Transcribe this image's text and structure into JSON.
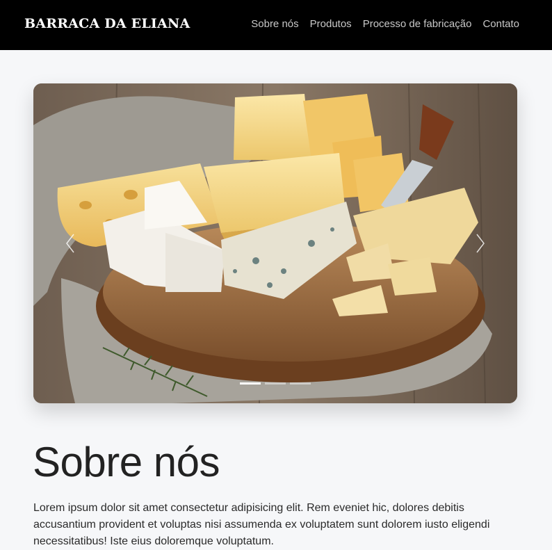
{
  "navbar": {
    "brand": "BARRACA DA ELIANA",
    "links": [
      "Sobre nós",
      "Produtos",
      "Processo de fabricação",
      "Contato"
    ]
  },
  "carousel": {
    "slide_alt": "Tábua com queijos",
    "prev_icon": "chevron-left-icon",
    "next_icon": "chevron-right-icon",
    "indicator_count": 3,
    "active_index": 0
  },
  "about": {
    "title": "Sobre nós",
    "text": "Lorem ipsum dolor sit amet consectetur adipisicing elit. Rem eveniet hic, dolores debitis accusantium provident et voluptas nisi assumenda ex voluptatem sunt dolorem iusto eligendi necessitatibus! Iste eius doloremque voluptatum."
  },
  "colors": {
    "navbar_bg": "#000000",
    "page_bg": "#f6f7f9"
  }
}
